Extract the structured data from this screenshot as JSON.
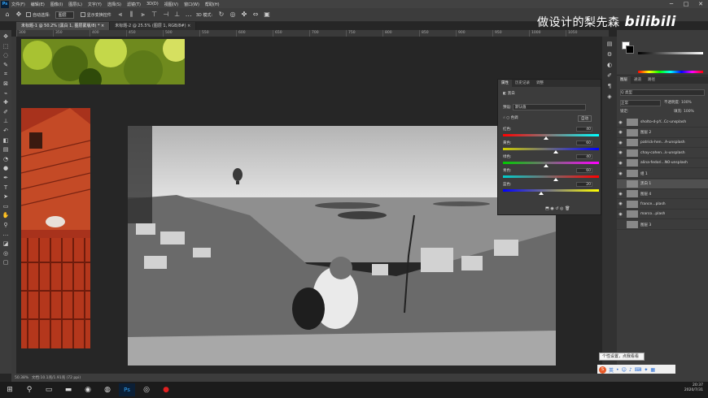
{
  "menu": {
    "logo": "Ps",
    "items": [
      "文件(F)",
      "编辑(E)",
      "图像(I)",
      "图层(L)",
      "文字(Y)",
      "选择(S)",
      "滤镜(T)",
      "3D(D)",
      "视图(V)",
      "窗口(W)",
      "帮助(H)"
    ]
  },
  "window_controls": [
    "─",
    "□",
    "✕"
  ],
  "options": {
    "auto_select_label": "自动选择:",
    "auto_select_value": "图层",
    "show_transform_label": "显示变换控件",
    "mode_3d_label": "3D 模式:"
  },
  "watermark": {
    "text": "做设计的梨先森",
    "brand": "bilibili"
  },
  "tabs": [
    {
      "label": "未标题-1 @ 50.2% (黑白 1, 图层蒙版/8) *",
      "close": "×"
    },
    {
      "label": "未标题-2 @ 25.5% (图层 1, RGB/8#)",
      "close": "×"
    }
  ],
  "ruler": [
    "300",
    "350",
    "400",
    "450",
    "500",
    "550",
    "600",
    "650",
    "700",
    "750",
    "800",
    "850",
    "900",
    "950",
    "1000",
    "1050"
  ],
  "status": {
    "zoom": "50.38%",
    "doc": "文档:10.1兆/1.91兆 (72 ppi)"
  },
  "properties": {
    "tabs": [
      "属性",
      "历史记录",
      "调整"
    ],
    "type": "黑白",
    "preset_label": "预设:",
    "preset_value": "默认值",
    "tint_label": "色调",
    "auto_label": "自动",
    "sliders": [
      {
        "label": "红色:",
        "value": "40",
        "pct": 0.45,
        "from": "#ff0000",
        "to": "#00ffff"
      },
      {
        "label": "黄色:",
        "value": "60",
        "pct": 0.55,
        "from": "#cccc00",
        "to": "#0000ff"
      },
      {
        "label": "绿色:",
        "value": "40",
        "pct": 0.45,
        "from": "#00cc00",
        "to": "#ff00ff"
      },
      {
        "label": "青色:",
        "value": "60",
        "pct": 0.55,
        "from": "#00cccc",
        "to": "#ff0000"
      },
      {
        "label": "蓝色:",
        "value": "20",
        "pct": 0.4,
        "from": "#0000ff",
        "to": "#ffff00"
      }
    ]
  },
  "layers": {
    "tabs": [
      "图层",
      "通道",
      "路径"
    ],
    "kind_label": "Q 类型",
    "blend_mode": "正常",
    "opacity_label": "不透明度:",
    "opacity": "100%",
    "lock_label": "锁定:",
    "fill_label": "填充:",
    "fill": "100%",
    "items": [
      {
        "name": "sholto-d-pY...Cc-unsplash",
        "eye": "◉"
      },
      {
        "name": "图层 2",
        "eye": "◉"
      },
      {
        "name": "patrick-hen...A-unsplash",
        "eye": "◉"
      },
      {
        "name": "chay-cohen...k-unsplash",
        "eye": "◉"
      },
      {
        "name": "alina-fedori...N0-unsplash",
        "eye": "◉"
      },
      {
        "name": "组 1",
        "eye": "◉"
      },
      {
        "name": "黑白 1",
        "eye": ""
      },
      {
        "name": "图层 4",
        "eye": "◉"
      },
      {
        "name": "france...plash",
        "eye": "◉"
      },
      {
        "name": "marco...plash",
        "eye": "◉"
      },
      {
        "name": "图层 3",
        "eye": ""
      }
    ]
  },
  "tooltip": "个性设置，点我看看",
  "taskbar": {
    "time": "20:37",
    "date": "2020/7/31",
    "lang": "英"
  }
}
